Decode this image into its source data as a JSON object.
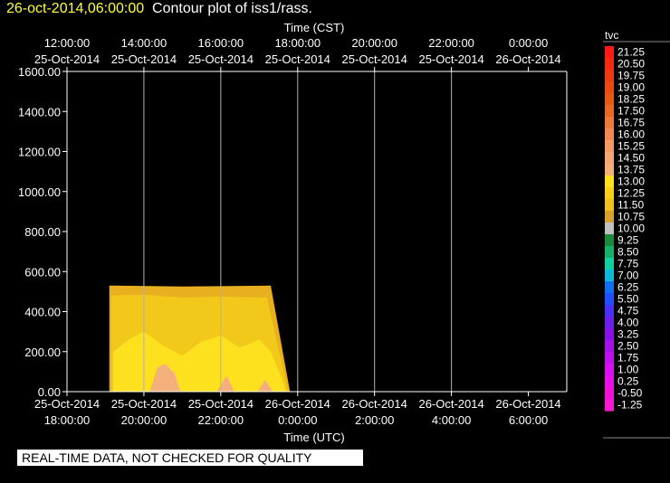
{
  "title": {
    "date": "26-oct-2014,06:00:00",
    "text": "Contour plot of iss1/rass."
  },
  "footer": {
    "banner": "REAL-TIME DATA, NOT CHECKED FOR QUALITY"
  },
  "chart_data": {
    "type": "heatmap",
    "variable": "tvc",
    "x_top_label": "Time (CST)",
    "x_bottom_label": "Time (UTC)",
    "ylabel": "",
    "ylim": [
      0,
      1600
    ],
    "xlim_hours_utc": [
      17.0,
      30.0
    ],
    "y_ticks": [
      "0.00",
      "200.00",
      "400.00",
      "600.00",
      "800.00",
      "1000.00",
      "1200.00",
      "1400.00",
      "1600.00"
    ],
    "y_tick_values": [
      0,
      200,
      400,
      600,
      800,
      1000,
      1200,
      1400,
      1600
    ],
    "x_tick_hours_utc": [
      17,
      19,
      21,
      23,
      25,
      27,
      29
    ],
    "x_ticks_bottom": [
      {
        "date": "25-Oct-2014",
        "time": "18:00:00"
      },
      {
        "date": "25-Oct-2014",
        "time": "20:00:00"
      },
      {
        "date": "25-Oct-2014",
        "time": "22:00:00"
      },
      {
        "date": "26-Oct-2014",
        "time": "0:00:00"
      },
      {
        "date": "26-Oct-2014",
        "time": "2:00:00"
      },
      {
        "date": "26-Oct-2014",
        "time": "4:00:00"
      },
      {
        "date": "26-Oct-2014",
        "time": "6:00:00"
      }
    ],
    "x_ticks_top": [
      {
        "time": "12:00:00",
        "date": "25-Oct-2014"
      },
      {
        "time": "14:00:00",
        "date": "25-Oct-2014"
      },
      {
        "time": "16:00:00",
        "date": "25-Oct-2014"
      },
      {
        "time": "18:00:00",
        "date": "25-Oct-2014"
      },
      {
        "time": "20:00:00",
        "date": "25-Oct-2014"
      },
      {
        "time": "22:00:00",
        "date": "25-Oct-2014"
      },
      {
        "time": "0:00:00",
        "date": "26-Oct-2014"
      }
    ],
    "grid": true,
    "data_extent": {
      "t_start_hours_utc": 18.1,
      "t_end_hours_utc": 22.3,
      "t_end_bottom_hours_utc": 22.8,
      "top_height": 530
    },
    "contour_regions": [
      {
        "level": 11.5,
        "color": "#e8b020",
        "polygon": [
          [
            18.1,
            0
          ],
          [
            18.1,
            530
          ],
          [
            20,
            525
          ],
          [
            22.3,
            530
          ],
          [
            22.8,
            0
          ]
        ]
      },
      {
        "level": 12.25,
        "color": "#f2c81a",
        "polygon": [
          [
            18.15,
            0
          ],
          [
            18.15,
            480
          ],
          [
            19,
            485
          ],
          [
            20,
            470
          ],
          [
            21,
            475
          ],
          [
            22.2,
            470
          ],
          [
            22.75,
            0
          ]
        ]
      },
      {
        "level": 13.0,
        "color": "#fde01e",
        "polygon": [
          [
            18.2,
            0
          ],
          [
            18.2,
            200
          ],
          [
            18.6,
            260
          ],
          [
            19,
            300
          ],
          [
            19.5,
            230
          ],
          [
            20,
            180
          ],
          [
            20.5,
            250
          ],
          [
            21,
            280
          ],
          [
            21.5,
            220
          ],
          [
            22,
            260
          ],
          [
            22.3,
            200
          ],
          [
            22.6,
            60
          ],
          [
            22.7,
            0
          ]
        ]
      },
      {
        "level": 13.75,
        "color": "#f4b07a",
        "polygon": [
          [
            19.15,
            0
          ],
          [
            19.35,
            120
          ],
          [
            19.55,
            140
          ],
          [
            19.8,
            90
          ],
          [
            19.95,
            0
          ]
        ]
      },
      {
        "level": 13.75,
        "color": "#f4b07a",
        "polygon": [
          [
            20.9,
            0
          ],
          [
            21.15,
            80
          ],
          [
            21.35,
            0
          ]
        ]
      },
      {
        "level": 13.75,
        "color": "#f4b07a",
        "polygon": [
          [
            21.95,
            0
          ],
          [
            22.15,
            60
          ],
          [
            22.35,
            0
          ]
        ]
      }
    ],
    "colorbar": {
      "label": "tvc",
      "levels": [
        {
          "label": "21.25",
          "color": "#ff1a1a"
        },
        {
          "label": "20.50",
          "color": "#f52a10"
        },
        {
          "label": "19.75",
          "color": "#ee3a10"
        },
        {
          "label": "19.00",
          "color": "#e84a10"
        },
        {
          "label": "18.25",
          "color": "#e65a10"
        },
        {
          "label": "17.50",
          "color": "#e86a20"
        },
        {
          "label": "16.75",
          "color": "#ec7a3a"
        },
        {
          "label": "16.00",
          "color": "#f08a52"
        },
        {
          "label": "15.25",
          "color": "#f49a66"
        },
        {
          "label": "14.50",
          "color": "#f4a674"
        },
        {
          "label": "13.75",
          "color": "#f4b07a"
        },
        {
          "label": "13.00",
          "color": "#fde01e"
        },
        {
          "label": "12.25",
          "color": "#f8d018"
        },
        {
          "label": "11.50",
          "color": "#f0c020"
        },
        {
          "label": "10.75",
          "color": "#d8a030"
        },
        {
          "label": "10.00",
          "color": "#c0c0c0"
        },
        {
          "label": "9.25",
          "color": "#1c8a3c"
        },
        {
          "label": "8.50",
          "color": "#16b06a"
        },
        {
          "label": "7.75",
          "color": "#10d0a0"
        },
        {
          "label": "7.00",
          "color": "#10b8d8"
        },
        {
          "label": "6.25",
          "color": "#1070f0"
        },
        {
          "label": "5.50",
          "color": "#2050ff"
        },
        {
          "label": "4.75",
          "color": "#4a30f0"
        },
        {
          "label": "4.00",
          "color": "#6a20e8"
        },
        {
          "label": "3.25",
          "color": "#8a10e8"
        },
        {
          "label": "2.50",
          "color": "#a810ea"
        },
        {
          "label": "1.75",
          "color": "#c010ee"
        },
        {
          "label": "1.00",
          "color": "#d810f0"
        },
        {
          "label": "0.25",
          "color": "#e810e8"
        },
        {
          "label": "-0.50",
          "color": "#f010d8"
        },
        {
          "label": "-1.25",
          "color": "#f818d0"
        }
      ]
    }
  }
}
